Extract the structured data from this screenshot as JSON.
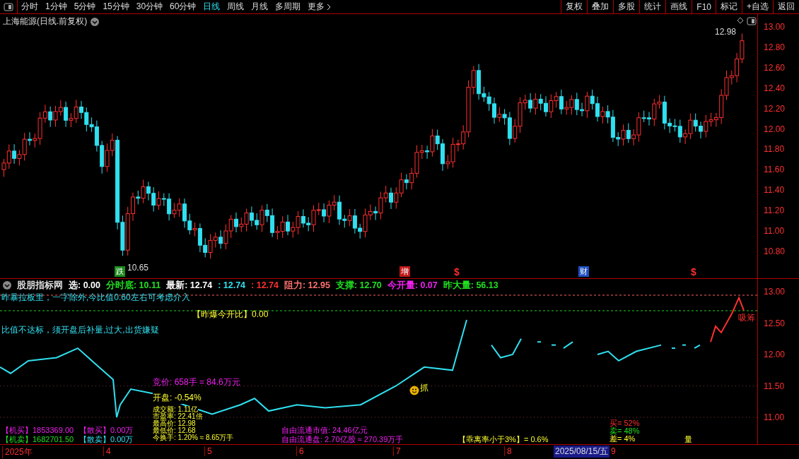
{
  "toolbar": {
    "periods": [
      {
        "label": "分时",
        "selected": false
      },
      {
        "label": "1分钟",
        "selected": false
      },
      {
        "label": "5分钟",
        "selected": false
      },
      {
        "label": "15分钟",
        "selected": false
      },
      {
        "label": "30分钟",
        "selected": false
      },
      {
        "label": "60分钟",
        "selected": false
      },
      {
        "label": "日线",
        "selected": true
      },
      {
        "label": "周线",
        "selected": false
      },
      {
        "label": "月线",
        "selected": false
      },
      {
        "label": "多周期",
        "selected": false
      },
      {
        "label": "更多",
        "selected": false
      }
    ],
    "actions": [
      "复权",
      "叠加",
      "多股",
      "统计",
      "画线",
      "F10",
      "标记",
      "+自选",
      "返回"
    ]
  },
  "main_chart": {
    "title": "上海能源(日线.前复权)",
    "high_label": "12.98",
    "low_label": "10.65",
    "markers": [
      {
        "text": "跌",
        "kind": "tag",
        "color": "#1c8a1c"
      },
      {
        "text": "增",
        "kind": "tag",
        "color": "#c01818"
      },
      {
        "text": "$",
        "kind": "symbol",
        "color": "#ff3030"
      },
      {
        "text": "财",
        "kind": "tag",
        "color": "#2050c0"
      },
      {
        "text": "$",
        "kind": "symbol",
        "color": "#ff3030"
      }
    ],
    "price_ticks": [
      "13.00",
      "12.80",
      "12.60",
      "12.40",
      "12.20",
      "12.00",
      "11.80",
      "11.60",
      "11.40",
      "11.20",
      "11.00",
      "10.80"
    ]
  },
  "indicator": {
    "name": "股朋指标网",
    "readouts": [
      {
        "text": "选: 0.00",
        "color": "#ffffff"
      },
      {
        "text": "分时底: 10.11",
        "color": "#20e020"
      },
      {
        "text": "最新: 12.74",
        "color": "#ffffff"
      },
      {
        "text": ": 12.74",
        "color": "#30e0f0"
      },
      {
        "text": ": 12.74",
        "color": "#ff3030"
      },
      {
        "text": "阻力: 12.95",
        "color": "#ff7070"
      },
      {
        "text": "支撑: 12.70",
        "color": "#20e020"
      },
      {
        "text": "今开量: 0.07",
        "color": "#f020f0"
      },
      {
        "text": "昨大量: 56.13",
        "color": "#20e020"
      }
    ],
    "note_top": "昨暴拉板里，一字除外,今比值0.60左右可考虑介入",
    "ratio_label": "【昨爆今开比】0.00",
    "note_bottom": "比值不达标，须开盘后补量,过大,出货嫌疑",
    "auction": "竞价: 658手 = 84.6万元",
    "open": "开盘: -0.54%",
    "stats": [
      "成交额: 1.11亿",
      "市盈率: 22.41倍",
      "最高价: 12.98",
      "最低价: 12.68",
      "今换手: 1.20% ≈ 8.65万手"
    ],
    "grab_label": "抓",
    "absorb_label": "吸筹",
    "flows": [
      {
        "text": "【机买】1853369.00",
        "color": "#f020f0"
      },
      {
        "text": "【散买】0.00万",
        "color": "#f020f0"
      },
      {
        "text": "【机卖】1682701.50",
        "color": "#20e020"
      },
      {
        "text": "【散卖】0.00万",
        "color": "#30e0f0"
      }
    ],
    "float_value": "自由流通市值: 24.46亿元",
    "float_shares": "自由流通盘: 2.70亿股 ≈ 270.39万手",
    "deviation": "【乖离率小于3%】= 0.6%",
    "buy_sell": [
      {
        "text": "买= 52%",
        "color": "#ff3030"
      },
      {
        "text": "卖= 48%",
        "color": "#20e020"
      },
      {
        "text": "差= 4%",
        "color": "#ffff30"
      }
    ],
    "volume_label": "量",
    "ticks": [
      "13.00",
      "12.50",
      "12.00",
      "11.50",
      "11.00"
    ]
  },
  "date_axis": {
    "labels": [
      "2025年",
      "4",
      "5",
      "6",
      "7",
      "8",
      "9"
    ],
    "cursor_date": "2025/08/15/五"
  }
}
